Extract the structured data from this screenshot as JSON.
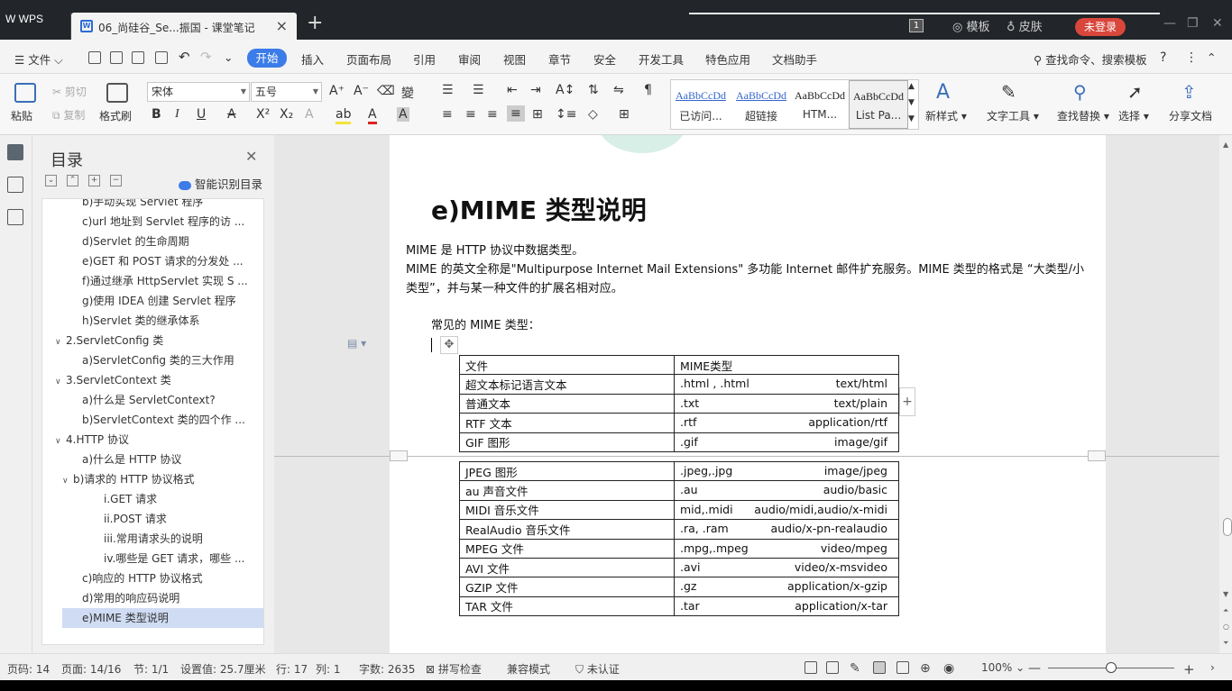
{
  "titlebar": {
    "app_name": "W WPS",
    "doc_tab": "06_尚硅谷_Se...振国 - 课堂笔记",
    "close": "×",
    "new_tab": "+",
    "page_badge": "1",
    "template": "模板",
    "skin": "皮肤",
    "login": "未登录"
  },
  "menubar": {
    "file": "文件",
    "tabs": [
      "开始",
      "插入",
      "页面布局",
      "引用",
      "审阅",
      "视图",
      "章节",
      "安全",
      "开发工具",
      "特色应用",
      "文档助手"
    ],
    "search": "查找命令、搜索模板",
    "help": "?"
  },
  "ribbon": {
    "paste": "粘贴",
    "cut": "剪切",
    "copy": "复制",
    "format_painter": "格式刷",
    "font_name": "宋体",
    "font_size": "五号",
    "styles": [
      {
        "sample": "AaBbCcDd",
        "name": "已访问...",
        "color": "#3366cc"
      },
      {
        "sample": "AaBbCcDd",
        "name": "超链接",
        "color": "#3366cc"
      },
      {
        "sample": "AaBbCcDd",
        "name": "HTM...",
        "color": "#222222"
      },
      {
        "sample": "AaBbCcDd",
        "name": "List Pa...",
        "color": "#222222"
      }
    ],
    "new_style": "新样式",
    "text_tools": "文字工具",
    "find_replace": "查找替换",
    "select": "选择",
    "share": "分享文档"
  },
  "toc": {
    "title": "目录",
    "smart_toc": "智能识别目录",
    "items": [
      {
        "label": "b)手动实现 Servlet 程序",
        "level": 2,
        "caret": ""
      },
      {
        "label": "c)url 地址到 Servlet 程序的访 ...",
        "level": 2,
        "caret": ""
      },
      {
        "label": "d)Servlet 的生命周期",
        "level": 2,
        "caret": ""
      },
      {
        "label": "e)GET 和 POST 请求的分发处 ...",
        "level": 2,
        "caret": ""
      },
      {
        "label": "f)通过继承 HttpServlet 实现 S ...",
        "level": 2,
        "caret": ""
      },
      {
        "label": "g)使用 IDEA 创建 Servlet 程序",
        "level": 2,
        "caret": ""
      },
      {
        "label": "h)Servlet 类的继承体系",
        "level": 2,
        "caret": ""
      },
      {
        "label": "2.ServletConfig 类",
        "level": 1,
        "caret": "∨"
      },
      {
        "label": "a)ServletConfig 类的三大作用",
        "level": 2,
        "caret": ""
      },
      {
        "label": "3.ServletContext 类",
        "level": 1,
        "caret": "∨"
      },
      {
        "label": "a)什么是 ServletContext?",
        "level": 2,
        "caret": ""
      },
      {
        "label": "b)ServletContext 类的四个作 ...",
        "level": 2,
        "caret": ""
      },
      {
        "label": "4.HTTP 协议",
        "level": 1,
        "caret": "∨"
      },
      {
        "label": "a)什么是 HTTP 协议",
        "level": 2,
        "caret": ""
      },
      {
        "label": "b)请求的 HTTP 协议格式",
        "level": 2,
        "caret": "∨"
      },
      {
        "label": "i.GET 请求",
        "level": 3,
        "caret": ""
      },
      {
        "label": "ii.POST 请求",
        "level": 3,
        "caret": ""
      },
      {
        "label": "iii.常用请求头的说明",
        "level": 3,
        "caret": ""
      },
      {
        "label": "iv.哪些是 GET 请求，哪些 ...",
        "level": 3,
        "caret": ""
      },
      {
        "label": "c)响应的 HTTP 协议格式",
        "level": 2,
        "caret": ""
      },
      {
        "label": "d)常用的响应码说明",
        "level": 2,
        "caret": ""
      },
      {
        "label": "e)MIME 类型说明",
        "level": 2,
        "caret": "",
        "selected": true
      }
    ]
  },
  "document": {
    "heading": "e)MIME 类型说明",
    "para1": "MIME 是 HTTP 协议中数据类型。",
    "para2": "MIME 的英文全称是\"Multipurpose Internet Mail Extensions\" 多功能 Internet 邮件扩充服务。MIME 类型的格式是 “大类型/小",
    "para3": "类型”，并与某一种文件的扩展名相对应。",
    "para4": "常见的 MIME 类型：",
    "table_header": [
      "文件",
      "MIME类型"
    ],
    "table_top": [
      [
        "超文本标记语言文本",
        ".html , .html",
        "text/html"
      ],
      [
        "普通文本",
        ".txt",
        "text/plain"
      ],
      [
        "RTF 文本",
        ".rtf",
        "application/rtf"
      ],
      [
        "GIF 图形",
        ".gif",
        "image/gif"
      ]
    ],
    "table_bottom": [
      [
        "JPEG 图形",
        ".jpeg,.jpg",
        "image/jpeg"
      ],
      [
        "au 声音文件",
        ".au",
        "audio/basic"
      ],
      [
        "MIDI 音乐文件",
        "mid,.midi",
        "audio/midi,audio/x-midi"
      ],
      [
        "RealAudio 音乐文件",
        ".ra, .ram",
        "audio/x-pn-realaudio"
      ],
      [
        "MPEG 文件",
        ".mpg,.mpeg",
        "video/mpeg"
      ],
      [
        "AVI 文件",
        ".avi",
        "video/x-msvideo"
      ],
      [
        "GZIP 文件",
        ".gz",
        "application/x-gzip"
      ],
      [
        "TAR 文件",
        ".tar",
        "application/x-tar"
      ]
    ]
  },
  "status": {
    "page_no": "页码: 14",
    "page_of": "页面: 14/16",
    "section": "节: 1/1",
    "setting": "设置值: 25.7厘米",
    "row": "行: 17",
    "col": "列: 1",
    "words": "字数: 2635",
    "spell": "拼写检查",
    "compat": "兼容模式",
    "cert": "未认证",
    "zoom": "100%"
  },
  "colors": {
    "accent": "#3b7ce8",
    "login": "#d9463b",
    "toc_selected": "#cfdcf3"
  }
}
